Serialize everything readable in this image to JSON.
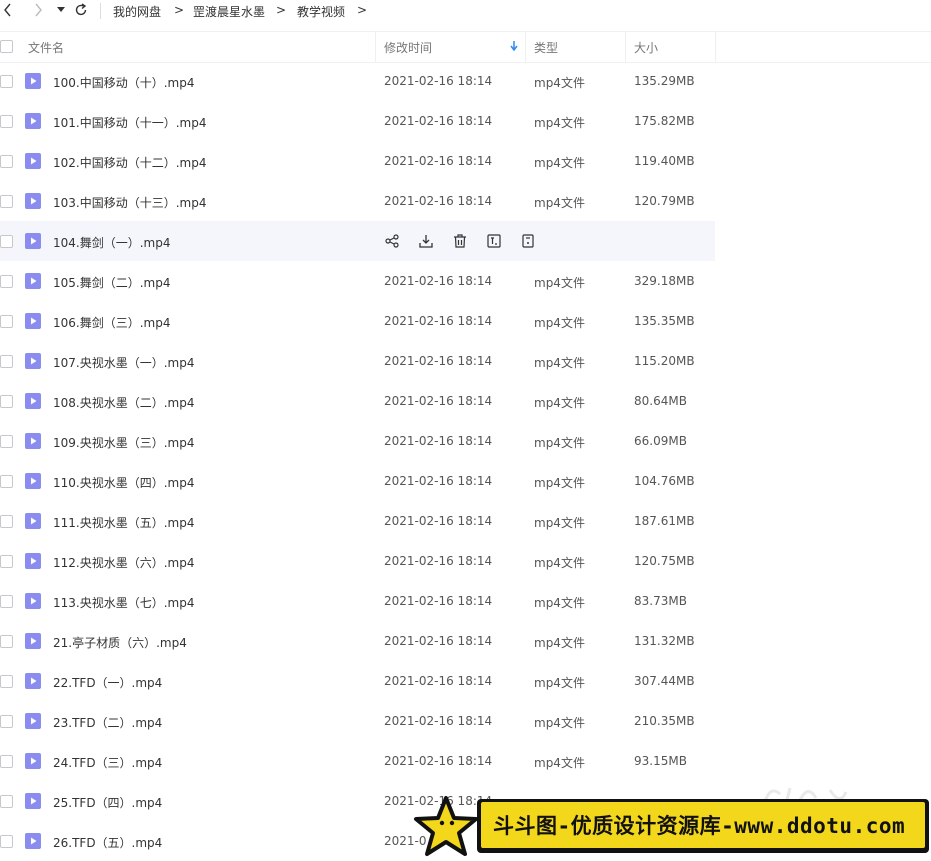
{
  "breadcrumb": {
    "items": [
      "我的网盘",
      "罡渡晨星水墨",
      "教学视频"
    ],
    "separator": ">"
  },
  "columns": {
    "name": "文件名",
    "modified": "修改时间",
    "type": "类型",
    "size": "大小"
  },
  "colors": {
    "file_icon": "#8a8cf0",
    "sort_arrow": "#2d8cf0",
    "banner_bg": "#f2d71a"
  },
  "rows": [
    {
      "name": "100.中国移动（十）.mp4",
      "date": "2021-02-16 18:14",
      "type": "mp4文件",
      "size": "135.29MB"
    },
    {
      "name": "101.中国移动（十一）.mp4",
      "date": "2021-02-16 18:14",
      "type": "mp4文件",
      "size": "175.82MB"
    },
    {
      "name": "102.中国移动（十二）.mp4",
      "date": "2021-02-16 18:14",
      "type": "mp4文件",
      "size": "119.40MB"
    },
    {
      "name": "103.中国移动（十三）.mp4",
      "date": "2021-02-16 18:14",
      "type": "mp4文件",
      "size": "120.79MB"
    },
    {
      "name": "104.舞剑（一）.mp4",
      "date": "",
      "type": "",
      "size": "",
      "hover": true
    },
    {
      "name": "105.舞剑（二）.mp4",
      "date": "2021-02-16 18:14",
      "type": "mp4文件",
      "size": "329.18MB"
    },
    {
      "name": "106.舞剑（三）.mp4",
      "date": "2021-02-16 18:14",
      "type": "mp4文件",
      "size": "135.35MB"
    },
    {
      "name": "107.央视水墨（一）.mp4",
      "date": "2021-02-16 18:14",
      "type": "mp4文件",
      "size": "115.20MB"
    },
    {
      "name": "108.央视水墨（二）.mp4",
      "date": "2021-02-16 18:14",
      "type": "mp4文件",
      "size": "80.64MB"
    },
    {
      "name": "109.央视水墨（三）.mp4",
      "date": "2021-02-16 18:14",
      "type": "mp4文件",
      "size": "66.09MB"
    },
    {
      "name": "110.央视水墨（四）.mp4",
      "date": "2021-02-16 18:14",
      "type": "mp4文件",
      "size": "104.76MB"
    },
    {
      "name": "111.央视水墨（五）.mp4",
      "date": "2021-02-16 18:14",
      "type": "mp4文件",
      "size": "187.61MB"
    },
    {
      "name": "112.央视水墨（六）.mp4",
      "date": "2021-02-16 18:14",
      "type": "mp4文件",
      "size": "120.75MB"
    },
    {
      "name": "113.央视水墨（七）.mp4",
      "date": "2021-02-16 18:14",
      "type": "mp4文件",
      "size": "83.73MB"
    },
    {
      "name": "21.亭子材质（六）.mp4",
      "date": "2021-02-16 18:14",
      "type": "mp4文件",
      "size": "131.32MB"
    },
    {
      "name": "22.TFD（一）.mp4",
      "date": "2021-02-16 18:14",
      "type": "mp4文件",
      "size": "307.44MB"
    },
    {
      "name": "23.TFD（二）.mp4",
      "date": "2021-02-16 18:14",
      "type": "mp4文件",
      "size": "210.35MB"
    },
    {
      "name": "24.TFD（三）.mp4",
      "date": "2021-02-16 18:14",
      "type": "mp4文件",
      "size": "93.15MB"
    },
    {
      "name": "25.TFD（四）.mp4",
      "date": "2021-02-16 18:14",
      "type": "",
      "size": ""
    },
    {
      "name": "26.TFD（五）.mp4",
      "date": "2021-0",
      "type": "",
      "size": ""
    }
  ],
  "row_actions": [
    "share-icon",
    "download-icon",
    "delete-icon",
    "rename-icon",
    "more-icon"
  ],
  "banner": {
    "text": "斗斗图-优质设计资源库-www.ddotu.com"
  }
}
